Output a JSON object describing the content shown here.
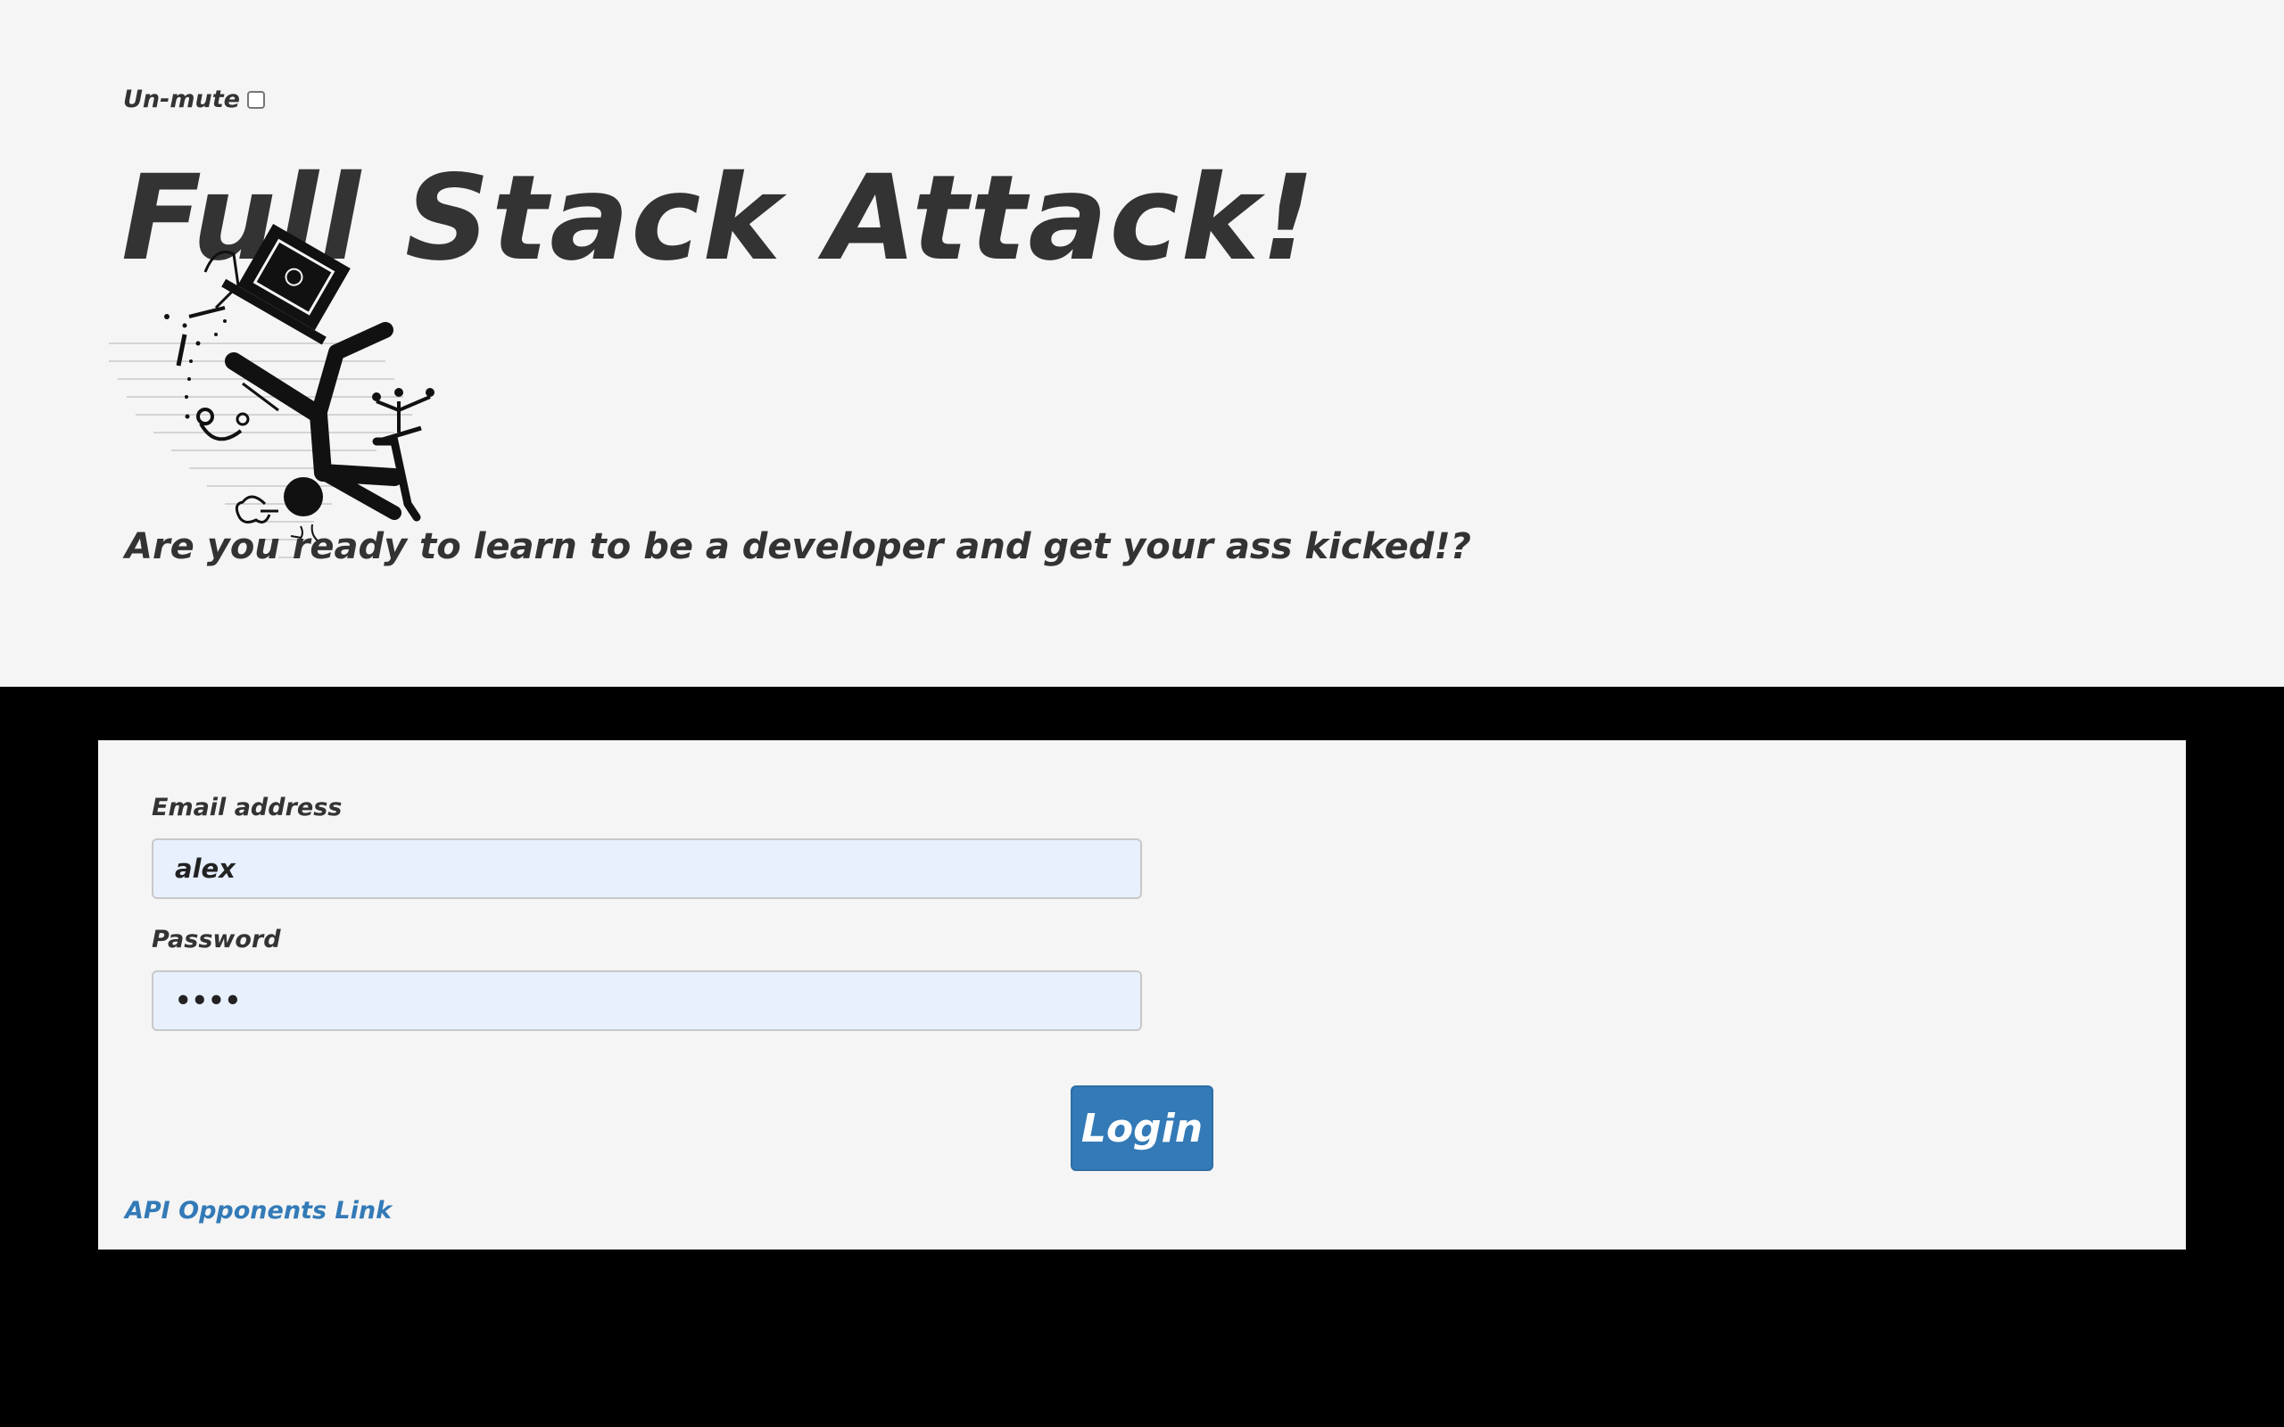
{
  "header": {
    "unmute_label": "Un-mute",
    "title": "Full Stack Attack!",
    "tagline": "Are you ready to learn to be a developer and get your ass kicked!?"
  },
  "login_form": {
    "email_label": "Email address",
    "email_value": "alex",
    "password_label": "Password",
    "password_value": "alex",
    "login_label": "Login",
    "api_link_label": "API Opponents Link"
  },
  "icons": {
    "hero_art": "person-crushed-by-falling-computer-icon"
  },
  "colors": {
    "background": "#f5f5f5",
    "backdrop": "#000000",
    "text": "#333333",
    "primary": "#337ab7",
    "input_fill": "#e8f0fe"
  }
}
